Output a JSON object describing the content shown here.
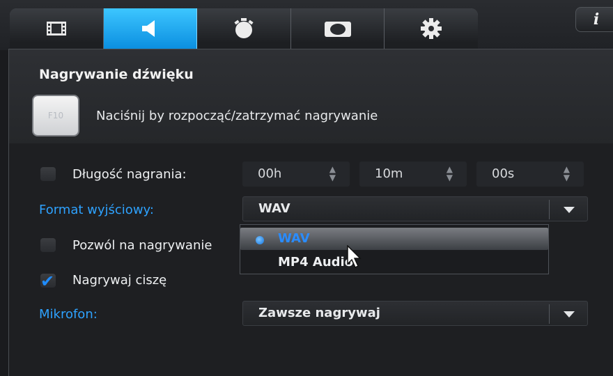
{
  "tabs": [
    {
      "icon": "film-icon",
      "active": false
    },
    {
      "icon": "speaker-icon",
      "active": true
    },
    {
      "icon": "stopwatch-icon",
      "active": false
    },
    {
      "icon": "camera-icon",
      "active": false
    },
    {
      "icon": "gear-icon",
      "active": false
    }
  ],
  "info_button": {
    "label": "i"
  },
  "section": {
    "title": "Nagrywanie dźwięku",
    "hotkey_label": "F10",
    "hotkey_hint": "Naciśnij by rozpocząć/zatrzymać nagrywanie"
  },
  "duration": {
    "label": "Długość nagrania:",
    "checked": false,
    "hours": "00h",
    "minutes": "10m",
    "seconds": "00s"
  },
  "output_format": {
    "label": "Format wyjściowy:",
    "value": "WAV",
    "options": [
      "WAV",
      "MP4 Audio"
    ],
    "selected": "WAV"
  },
  "allow_recording": {
    "label": "Pozwól na nagrywanie",
    "checked": false
  },
  "record_silence": {
    "label": "Nagrywaj ciszę",
    "checked": true
  },
  "microphone": {
    "label": "Mikrofon:",
    "value": "Zawsze nagrywaj"
  },
  "colors": {
    "accent": "#1a9cf0",
    "label_blue": "#2ea2ff"
  }
}
